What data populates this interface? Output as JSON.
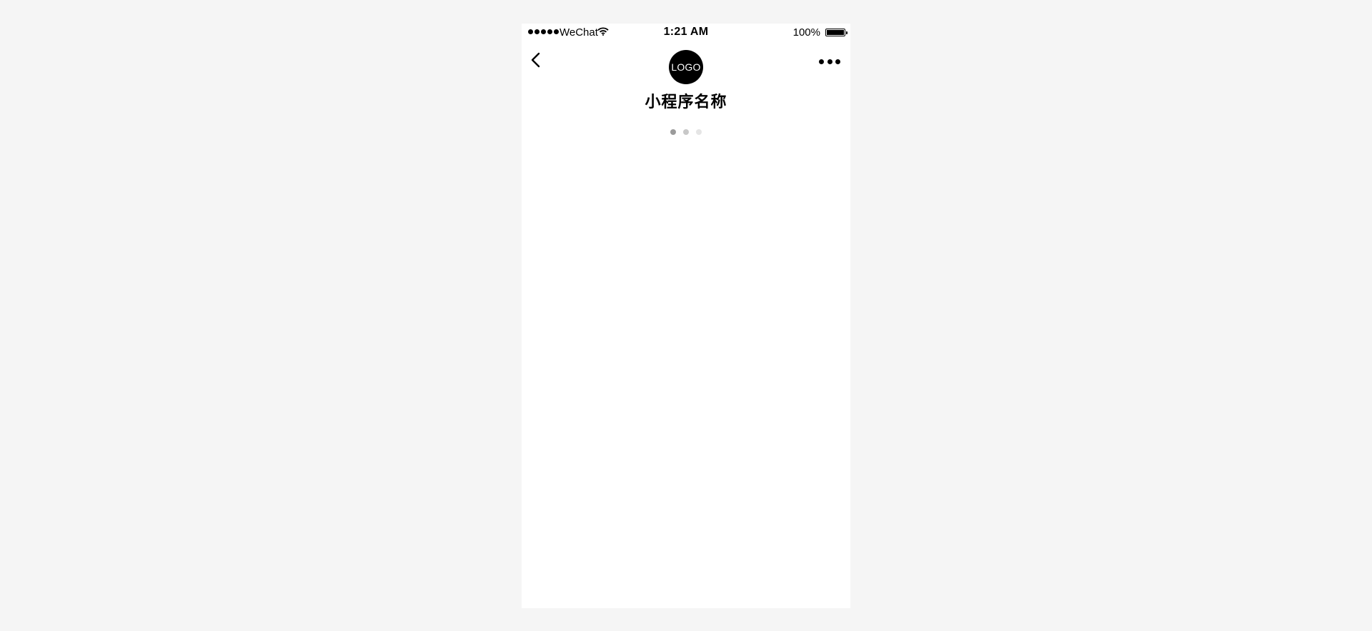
{
  "status_bar": {
    "carrier": "WeChat",
    "time": "1:21 AM",
    "battery_percent": "100%",
    "icons": [
      "signal-dots-icon",
      "wifi-icon",
      "battery-icon"
    ]
  },
  "nav": {
    "back_icon": "chevron-left-icon",
    "more_icon": "more-dots-icon"
  },
  "app": {
    "logo_text": "LOGO",
    "name": "小程序名称"
  },
  "loading_indicator": {
    "dot_count": 3,
    "colors": [
      "#9b9b9b",
      "#c8c8c8",
      "#e5e5e5"
    ]
  }
}
